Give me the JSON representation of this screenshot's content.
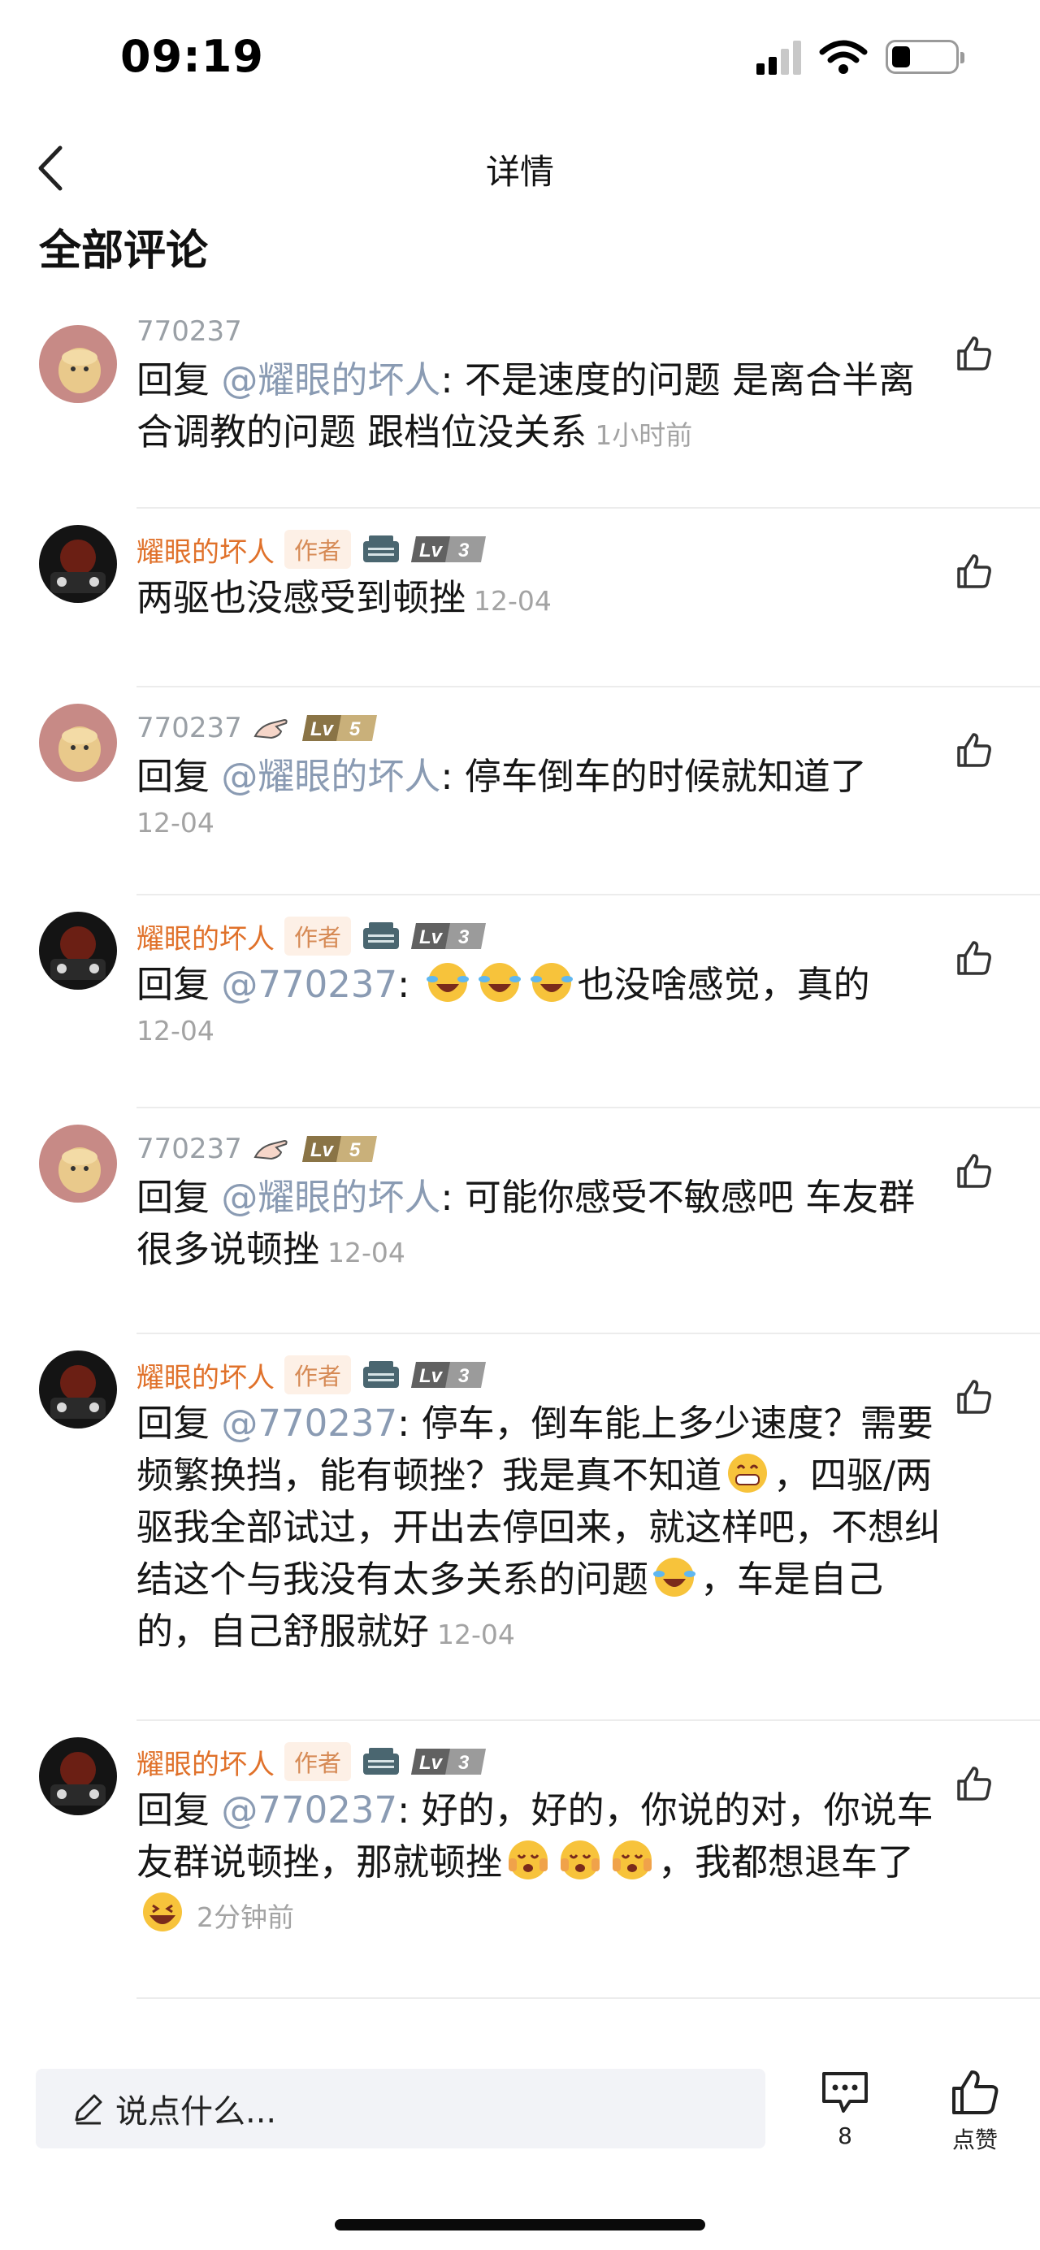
{
  "status_bar": {
    "time": "09:19",
    "battery_level": 0.3
  },
  "nav": {
    "title": "详情"
  },
  "section_title": "全部评论",
  "comments": [
    {
      "user": "770237",
      "author": false,
      "lv": "",
      "reply_prefix": "回复",
      "mention": "@耀眼的坏人",
      "text": ": 不是速度的问题 是离合半离合调教的问题 跟档位没关系",
      "time": "1小时前"
    },
    {
      "user": "耀眼的坏人",
      "author": true,
      "author_tag": "作者",
      "lv": "3",
      "text": "两驱也没感受到顿挫",
      "time": "12-04"
    },
    {
      "user": "770237",
      "author": false,
      "lv": "5",
      "reply_prefix": "回复",
      "mention": "@耀眼的坏人",
      "text": ": 停车倒车的时候就知道了",
      "time": "12-04"
    },
    {
      "user": "耀眼的坏人",
      "author": true,
      "author_tag": "作者",
      "lv": "3",
      "reply_prefix": "回复",
      "mention": "@770237",
      "text_a": ": ",
      "text_b": "也没啥感觉，真的",
      "time": "12-04"
    },
    {
      "user": "770237",
      "author": false,
      "lv": "5",
      "reply_prefix": "回复",
      "mention": "@耀眼的坏人",
      "text": ": 可能你感受不敏感吧 车友群很多说顿挫",
      "time": "12-04"
    },
    {
      "user": "耀眼的坏人",
      "author": true,
      "author_tag": "作者",
      "lv": "3",
      "reply_prefix": "回复",
      "mention": "@770237",
      "text_a": ": 停车，倒车能上多少速度？需要频繁换挡，能有顿挫？我是真不知道",
      "text_b": "，四驱/两驱我全部试过，开出去停回来，就这样吧，不想纠结这个与我没有太多关系的问题",
      "text_c": "，车是自己的，自己舒服就好",
      "time": "12-04"
    },
    {
      "user": "耀眼的坏人",
      "author": true,
      "author_tag": "作者",
      "lv": "3",
      "reply_prefix": "回复",
      "mention": "@770237",
      "text_a": ": 好的，好的，你说的对，你说车友群说顿挫，那就顿挫",
      "text_b": "，我都想退车了",
      "time": "2分钟前"
    }
  ],
  "bottom_bar": {
    "placeholder": "说点什么...",
    "comment_count": "8",
    "like_label": "点赞"
  }
}
